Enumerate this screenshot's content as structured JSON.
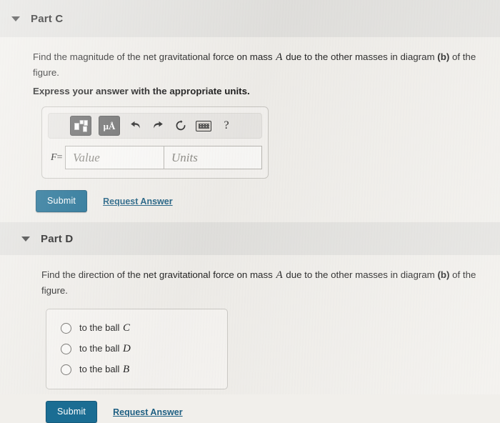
{
  "part_c": {
    "title": "Part C",
    "collapse_icon": "triangle-down-icon",
    "question": "Find the magnitude of the net gravitational force on mass ",
    "question_var": "A",
    "question_cont": " due to the other masses in diagram ",
    "question_diagram": "(b)",
    "question_end": " of the figure.",
    "instruction": "Express your answer with the appropriate units.",
    "toolbar": {
      "template_button": "template-matrix-icon",
      "units_button": "μÅ",
      "undo_button": "undo-icon",
      "redo_button": "redo-icon",
      "reset_button": "reset-icon",
      "keyboard_button": "keyboard-icon",
      "help_button": "?"
    },
    "field_label": "F",
    "field_equals": "=",
    "value_placeholder": "Value",
    "units_placeholder": "Units",
    "submit_label": "Submit",
    "request_answer_label": "Request Answer"
  },
  "part_d": {
    "title": "Part D",
    "collapse_icon": "triangle-down-icon",
    "question": "Find the direction of the net gravitational force on mass ",
    "question_var": "A",
    "question_cont": " due to the other masses in diagram ",
    "question_diagram": "(b)",
    "question_end": " of the figure.",
    "options": [
      {
        "prefix": "to the ball ",
        "symbol": "C",
        "selected": false
      },
      {
        "prefix": "to the ball ",
        "symbol": "D",
        "selected": false
      },
      {
        "prefix": "to the ball ",
        "symbol": "B",
        "selected": false
      }
    ],
    "submit_label": "Submit",
    "request_answer_label": "Request Answer"
  },
  "colors": {
    "submit_button": "#1b6d93",
    "link": "#1e5f82",
    "header_bar": "#e3e2df",
    "page_background": "#f1efeb"
  }
}
